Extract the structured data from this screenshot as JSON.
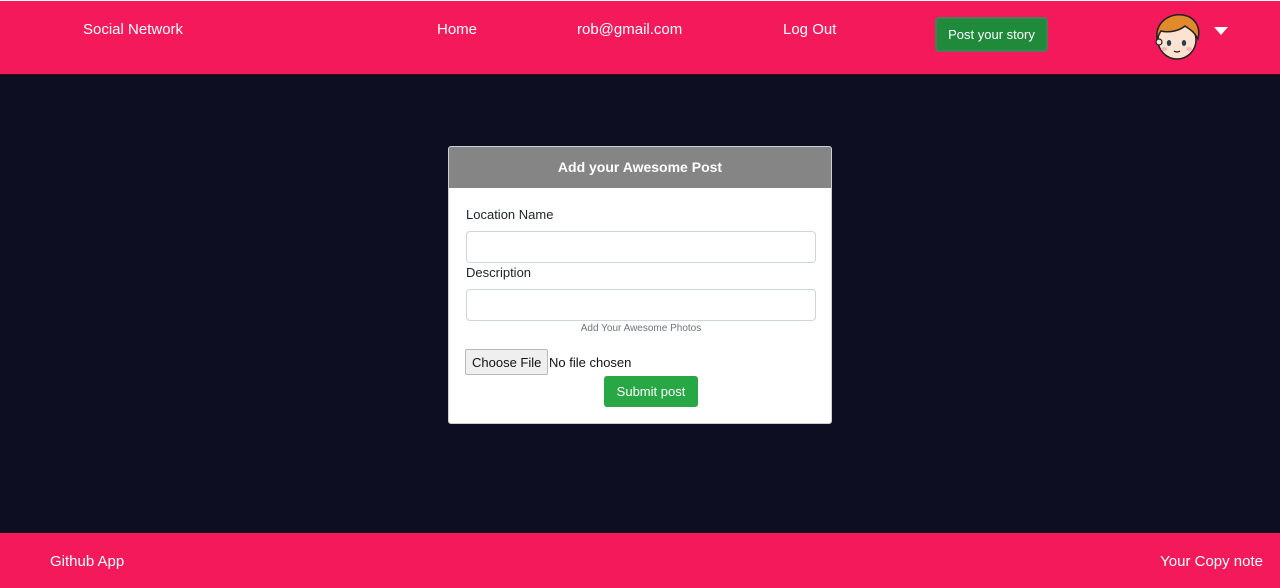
{
  "navbar": {
    "brand": "Social Network",
    "links": {
      "home": "Home",
      "email": "rob@gmail.com",
      "logout": "Log Out"
    },
    "story_button": "Post your story",
    "avatar_icon": "cartoon-face-avatar",
    "dropdown_icon": "caret-down-icon",
    "colors": {
      "background": "#f3195a",
      "story_button": "#1f8a3a"
    }
  },
  "form": {
    "header": "Add your Awesome Post",
    "location_label": "Location Name",
    "location_value": "",
    "description_label": "Description",
    "description_value": "",
    "photos_hint": "Add Your Awesome Photos",
    "file_button": "Choose File",
    "file_status": "No file chosen",
    "submit_button": "Submit post",
    "colors": {
      "header": "#858585",
      "submit": "#28a745"
    }
  },
  "footer": {
    "left": "Github App",
    "right": "Your Copy note"
  },
  "colors": {
    "page_background": "#0d0e21"
  }
}
